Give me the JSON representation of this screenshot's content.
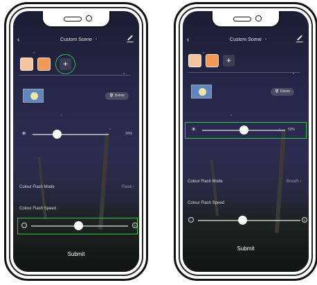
{
  "screens": [
    {
      "title": "Custom Scene",
      "back_label": "‹",
      "add_label": "+",
      "swatch_colors": [
        "#f6c59e",
        "#f19a58"
      ],
      "delete_label": "Delete",
      "brightness_value": "20%",
      "flash_mode_label": "Colour Flash Mode",
      "flash_mode_value": "Flash",
      "flash_speed_label": "Colour Flash Speed",
      "submit_label": "Submit"
    },
    {
      "title": "Custom Scene",
      "back_label": "‹",
      "add_label": "+",
      "swatch_colors": [
        "#f6c59e",
        "#f19a58"
      ],
      "delete_label": "Delete",
      "brightness_value": "50%",
      "flash_mode_label": "Colour Flash Mode",
      "flash_mode_value": "Breath",
      "flash_speed_label": "Colour Flash Speed",
      "submit_label": "Submit"
    }
  ],
  "highlight_color": "#31c44f"
}
